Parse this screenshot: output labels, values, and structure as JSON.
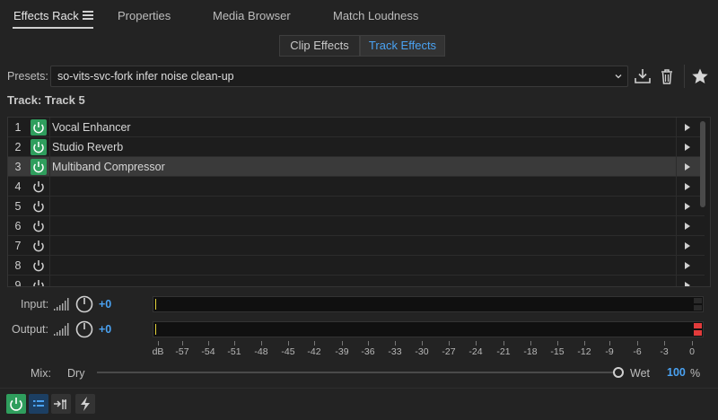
{
  "tabs": [
    {
      "label": "Effects Rack",
      "active": true
    },
    {
      "label": "Properties",
      "active": false
    },
    {
      "label": "Media Browser",
      "active": false
    },
    {
      "label": "Match Loudness",
      "active": false
    }
  ],
  "segments": [
    {
      "label": "Clip Effects",
      "active": false
    },
    {
      "label": "Track Effects",
      "active": true
    }
  ],
  "presets": {
    "label": "Presets:",
    "value": "so-vits-svc-fork infer noise clean-up"
  },
  "track_title": "Track: Track 5",
  "rack_rows": [
    {
      "num": "1",
      "name": "Vocal Enhancer",
      "on": true,
      "selected": false
    },
    {
      "num": "2",
      "name": "Studio Reverb",
      "on": true,
      "selected": false
    },
    {
      "num": "3",
      "name": "Multiband Compressor",
      "on": true,
      "selected": true
    },
    {
      "num": "4",
      "name": "",
      "on": false,
      "selected": false
    },
    {
      "num": "5",
      "name": "",
      "on": false,
      "selected": false
    },
    {
      "num": "6",
      "name": "",
      "on": false,
      "selected": false
    },
    {
      "num": "7",
      "name": "",
      "on": false,
      "selected": false
    },
    {
      "num": "8",
      "name": "",
      "on": false,
      "selected": false
    },
    {
      "num": "9",
      "name": "",
      "on": false,
      "selected": false
    }
  ],
  "io": {
    "input_label": "Input:",
    "input_gain": "+0",
    "output_label": "Output:",
    "output_gain": "+0"
  },
  "scale_labels": [
    "dB",
    "-57",
    "-54",
    "-51",
    "-48",
    "-45",
    "-42",
    "-39",
    "-36",
    "-33",
    "-30",
    "-27",
    "-24",
    "-21",
    "-18",
    "-15",
    "-12",
    "-9",
    "-6",
    "-3",
    "0"
  ],
  "mix": {
    "label": "Mix:",
    "dry_label": "Dry",
    "wet_label": "Wet",
    "value": "100",
    "unit": "%"
  },
  "colors": {
    "accent_blue": "#4aa2f2",
    "power_green": "#2f9e5d",
    "clip_red": "#e23b3b",
    "peak_yellow": "#e3d23a"
  },
  "icons": {
    "menu": "hamburger-menu-icon",
    "save_preset": "download-tray-icon",
    "delete_preset": "trash-icon",
    "favorite": "star-icon",
    "power": "power-icon",
    "expand": "triangle-right-icon",
    "input_bars": "signal-bars-icon",
    "knob": "knob-icon",
    "list": "list-icon",
    "route": "route-arrow-icon",
    "bolt": "lightning-bolt-icon"
  }
}
